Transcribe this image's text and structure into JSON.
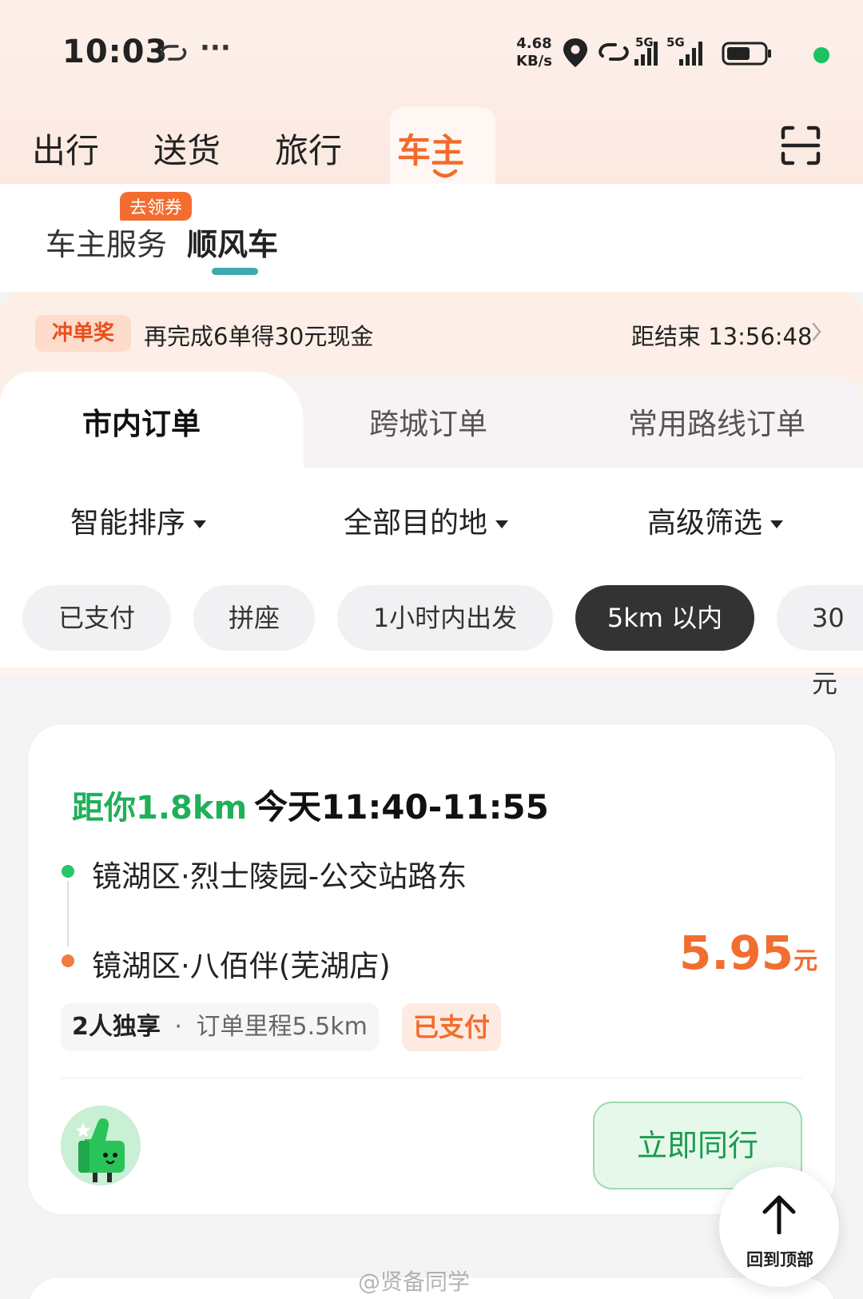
{
  "status_bar": {
    "time": "10:03",
    "dots": "···",
    "net_speed_value": "4.68",
    "net_speed_unit": "KB/s",
    "signal1": "5G",
    "signal2": "5G"
  },
  "top_tabs": [
    "出行",
    "送货",
    "旅行",
    "车主"
  ],
  "active_top_tab": "车主",
  "sub_tabs": {
    "service": "车主服务",
    "carpool": "顺风车",
    "coupon_badge": "去领券"
  },
  "promo": {
    "tag": "冲单奖",
    "text": "再完成6单得30元现金",
    "countdown": "距结束 13:56:48"
  },
  "order_tabs": [
    "市内订单",
    "跨城订单",
    "常用路线订单"
  ],
  "filters": [
    "智能排序",
    "全部目的地",
    "高级筛选"
  ],
  "chips": [
    "已支付",
    "拼座",
    "1小时内出发",
    "5km 以内",
    "30元"
  ],
  "active_chip": "5km 以内",
  "order": {
    "distance": "距你1.8km",
    "time": "今天11:40-11:55",
    "start": "镜湖区·烈士陵园-公交站路东",
    "end": "镜湖区·八佰伴(芜湖店)",
    "price": "5.95",
    "price_unit": "元",
    "passengers": "2人独享",
    "separator": "·",
    "mileage": "订单里程5.5km",
    "status": "已支付",
    "action": "立即同行"
  },
  "back_to_top": "回到顶部",
  "watermark": "@贤备同学",
  "colors": {
    "accent_orange": "#f26d2f",
    "green": "#1fb05a",
    "teal_indicator": "#3fa9b0"
  }
}
